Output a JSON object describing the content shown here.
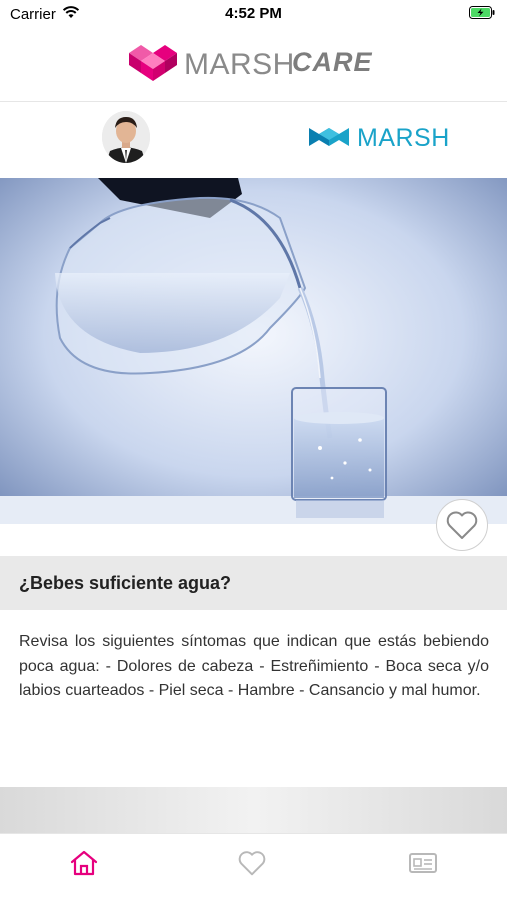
{
  "status_bar": {
    "carrier": "Carrier",
    "time": "4:52 PM"
  },
  "header": {
    "brand_name": "MARSH",
    "brand_suffix": "CARE"
  },
  "profile_row": {
    "partner_name": "MARSH"
  },
  "article": {
    "title": "¿Bebes suficiente agua?",
    "body": "Revisa los siguientes síntomas que indican que estás bebiendo poca agua: - Dolores de cabeza - Estreñimiento - Boca seca y/o labios cuarteados - Piel seca - Hambre - Cansancio y mal humor."
  },
  "tab_bar": {
    "items": [
      {
        "icon": "home-icon",
        "active": true
      },
      {
        "icon": "heart-icon",
        "active": false
      },
      {
        "icon": "id-card-icon",
        "active": false
      }
    ]
  },
  "colors": {
    "brand_pink": "#e6007e",
    "partner_blue": "#1aa3c9",
    "inactive_icon": "#b8b8b8"
  }
}
